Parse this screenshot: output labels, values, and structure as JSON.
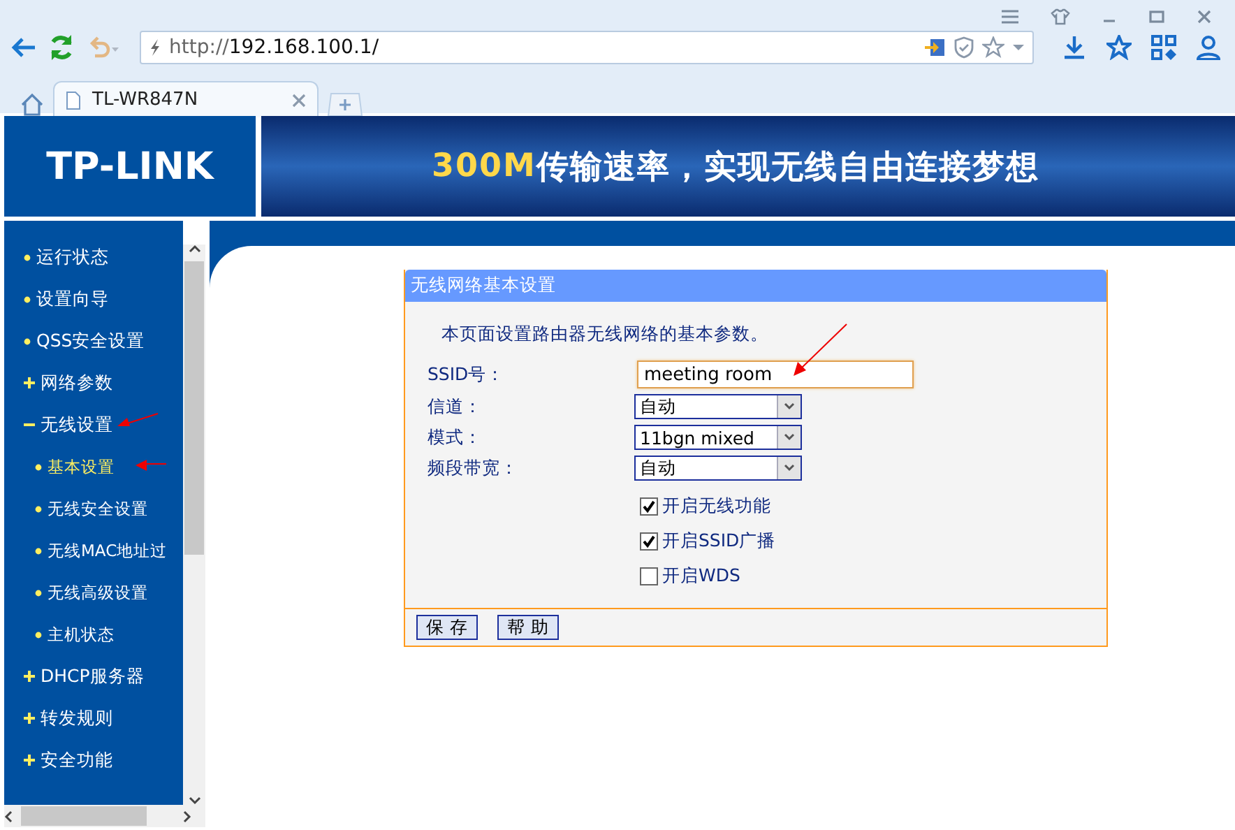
{
  "browser": {
    "url_prefix": "http://",
    "url": "192.168.100.1/",
    "tab_title": "TL-WR847N"
  },
  "banner": {
    "logo": "TP-LINK",
    "slogan_highlight": "300M",
    "slogan": "传输速率，实现无线自由连接梦想"
  },
  "sidebar": {
    "items": [
      {
        "label": "运行状态",
        "kind": "page",
        "selected": false
      },
      {
        "label": "设置向导",
        "kind": "page",
        "selected": false
      },
      {
        "label": "QSS安全设置",
        "kind": "page",
        "selected": false
      },
      {
        "label": "网络参数",
        "kind": "folder",
        "expanded": false
      },
      {
        "label": "无线设置",
        "kind": "folder",
        "expanded": true,
        "children": [
          {
            "label": "基本设置",
            "kind": "page",
            "selected": true
          },
          {
            "label": "无线安全设置",
            "kind": "page",
            "selected": false
          },
          {
            "label": "无线MAC地址过",
            "kind": "page",
            "selected": false
          },
          {
            "label": "无线高级设置",
            "kind": "page",
            "selected": false
          },
          {
            "label": "主机状态",
            "kind": "page",
            "selected": false
          }
        ]
      },
      {
        "label": "DHCP服务器",
        "kind": "folder",
        "expanded": false
      },
      {
        "label": "转发规则",
        "kind": "folder",
        "expanded": false
      },
      {
        "label": "安全功能",
        "kind": "folder",
        "expanded": false
      }
    ]
  },
  "panel": {
    "title": "无线网络基本设置",
    "intro": "本页面设置路由器无线网络的基本参数。",
    "fields": [
      {
        "label": "SSID号：",
        "kind": "text",
        "value": "meeting room"
      },
      {
        "label": "信道：",
        "kind": "select",
        "value": "自动"
      },
      {
        "label": "模式：",
        "kind": "select",
        "value": "11bgn mixed"
      },
      {
        "label": "频段带宽：",
        "kind": "select",
        "value": "自动"
      }
    ],
    "checkboxes": [
      {
        "label": "开启无线功能",
        "checked": true
      },
      {
        "label": "开启SSID广播",
        "checked": true
      },
      {
        "label": "开启WDS",
        "checked": false
      }
    ],
    "buttons": [
      "保 存",
      "帮 助"
    ]
  }
}
